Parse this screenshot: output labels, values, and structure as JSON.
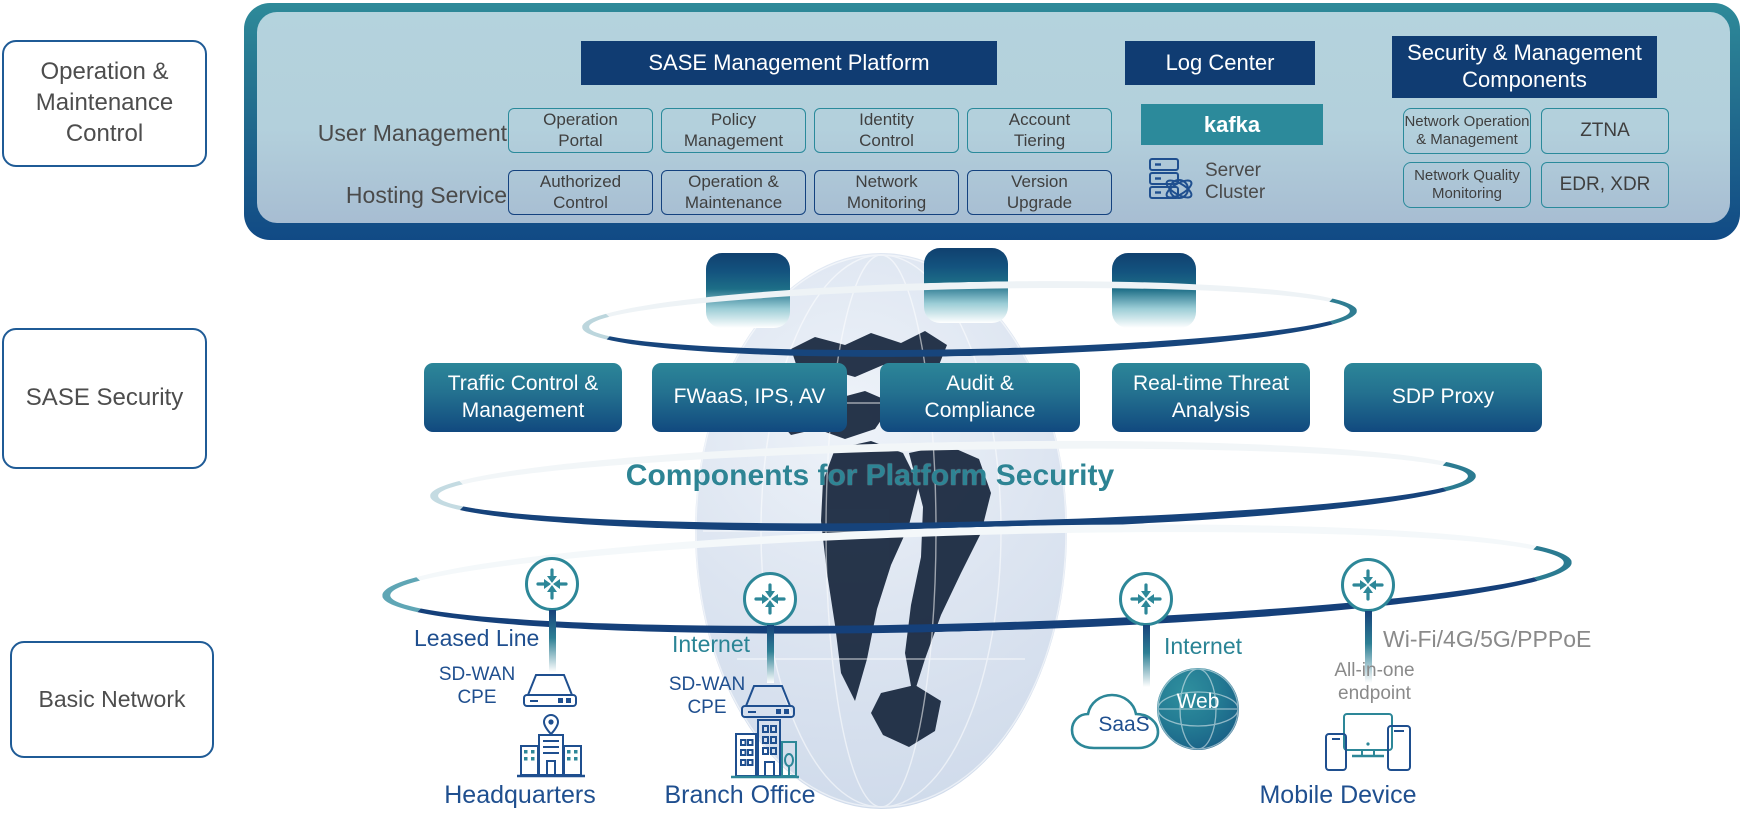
{
  "tiers": [
    {
      "id": "operation-maintenance-control",
      "label": "Operation &\nMaintenance\nControl"
    },
    {
      "id": "sase-security",
      "label": "SASE Security"
    },
    {
      "id": "basic-network",
      "label": "Basic Network"
    }
  ],
  "management_panel": {
    "headers": {
      "sase_platform": "SASE Management Platform",
      "log_center": "Log Center",
      "security_management": "Security & Management\nComponents"
    },
    "rows": [
      {
        "label": "User Management",
        "items": [
          "Operation\nPortal",
          "Policy\nManagement",
          "Identity\nControl",
          "Account\nTiering"
        ]
      },
      {
        "label": "Hosting Service",
        "items": [
          "Authorized\nControl",
          "Operation &\nMaintenance",
          "Network\nMonitoring",
          "Version\nUpgrade"
        ]
      }
    ],
    "log_center": {
      "kafka_label": "kafka",
      "server_cluster_label": "Server\nCluster",
      "server_icon": "server-stack-icon"
    },
    "security_components": [
      "Network Operation\n& Management",
      "ZTNA",
      "Network Quality\nMonitoring",
      "EDR, XDR"
    ]
  },
  "sase_security": {
    "services": [
      "Traffic Control &\nManagement",
      "FWaaS, IPS, AV",
      "Audit &\nCompliance",
      "Real-time Threat\nAnalysis",
      "SDP Proxy"
    ],
    "platform_security_caption": "Components for Platform Security"
  },
  "basic_network": {
    "nodes": [
      {
        "id": "headquarters",
        "link_label": "Leased Line",
        "device_label": "SD-WAN\nCPE",
        "site_label": "Headquarters",
        "router_icon": "router-icon",
        "device_icon": "cpe-box-icon",
        "site_icon": "office-building-icon"
      },
      {
        "id": "branch-office",
        "link_label": "Internet",
        "device_label": "SD-WAN\nCPE",
        "site_label": "Branch Office",
        "router_icon": "router-icon",
        "device_icon": "cpe-box-icon",
        "site_icon": "branch-building-icon"
      },
      {
        "id": "cloud-services",
        "link_label": "Internet",
        "saas_label": "SaaS",
        "web_label": "Web",
        "router_icon": "router-icon",
        "cloud_icon": "cloud-icon",
        "web_icon": "web-globe-icon"
      },
      {
        "id": "mobile-device",
        "link_label": "Wi-Fi/4G/5G/PPPoE",
        "device_label": "All-in-one\nendpoint",
        "site_label": "Mobile Device",
        "router_icon": "router-icon",
        "device_icon": "multi-device-icon"
      }
    ]
  },
  "colors": {
    "navy": "#103c72",
    "teal": "#2c8a9b",
    "panel_border_top": "#2e8a99",
    "panel_border_bottom": "#114a85",
    "panel_fill": "#b4d3dd",
    "label_text": "#4d4d4d",
    "caption_teal": "#2d8494",
    "link_gray": "#8a8a8a",
    "link_blue": "#1f4f8f"
  }
}
